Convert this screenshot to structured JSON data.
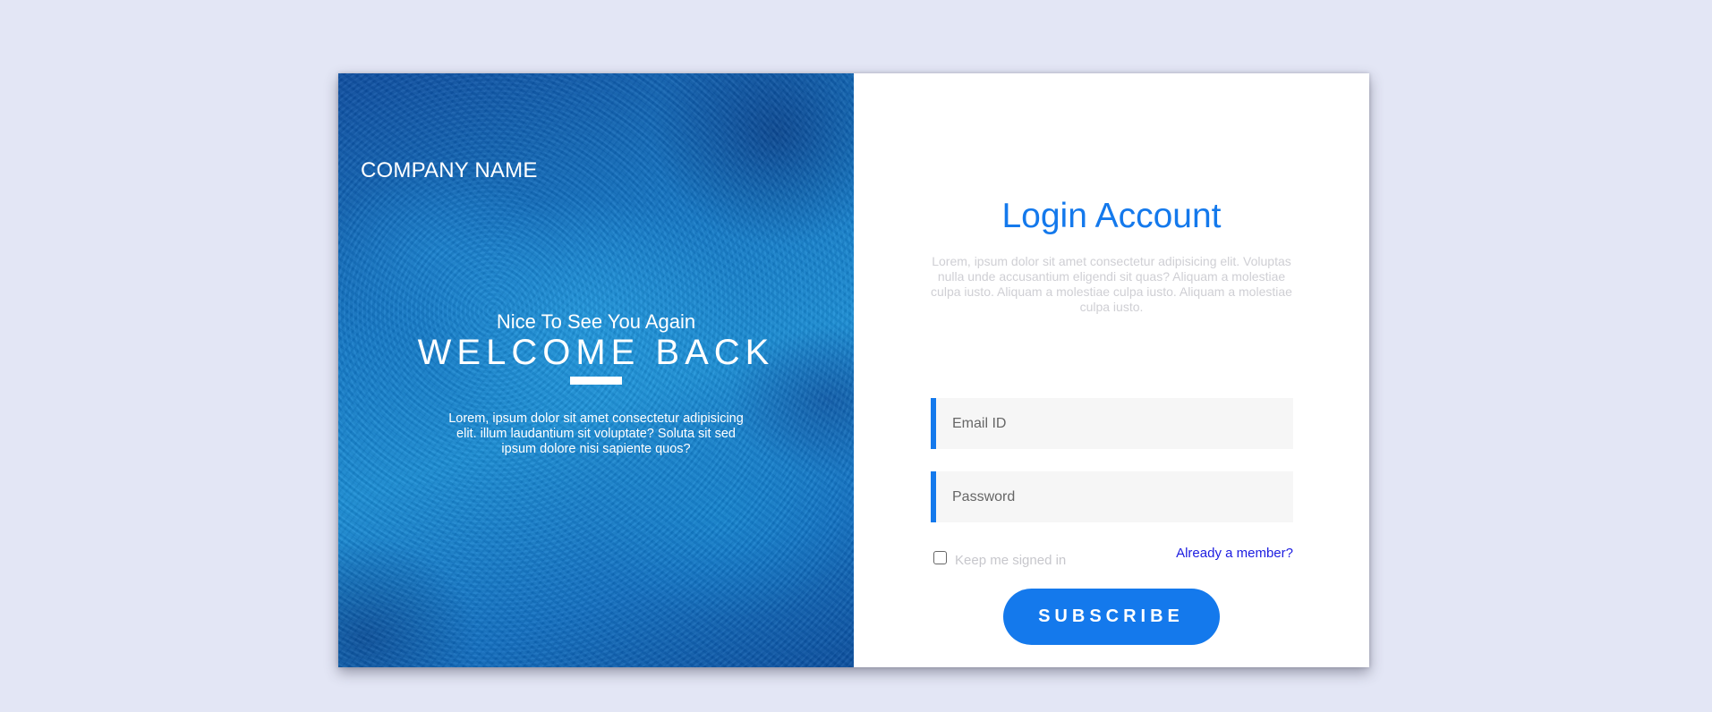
{
  "colors": {
    "page_background": "#e3e6f5",
    "accent": "#1479ec",
    "link": "#1c1ce0",
    "field_background": "#f6f6f6",
    "muted_text": "#cfcfd4"
  },
  "left_panel": {
    "company_name": "COMPANY NAME",
    "greeting": "Nice To See You Again",
    "heading": "WELCOME BACK",
    "description": "Lorem, ipsum dolor sit amet consectetur adipisicing elit. illum laudantium sit voluptate? Soluta sit sed ipsum dolore nisi sapiente quos?"
  },
  "right_panel": {
    "title": "Login Account",
    "description": "Lorem, ipsum dolor sit amet consectetur adipisicing elit. Voluptas nulla unde accusantium eligendi sit quas? Aliquam a molestiae culpa iusto. Aliquam a molestiae culpa iusto. Aliquam a molestiae culpa iusto.",
    "email_field": {
      "placeholder": "Email ID",
      "value": ""
    },
    "password_field": {
      "placeholder": "Password",
      "value": ""
    },
    "remember_me": {
      "label": "Keep me signed in",
      "checked": false
    },
    "member_link": "Already a member?",
    "submit_label": "SUBSCRIBE"
  }
}
